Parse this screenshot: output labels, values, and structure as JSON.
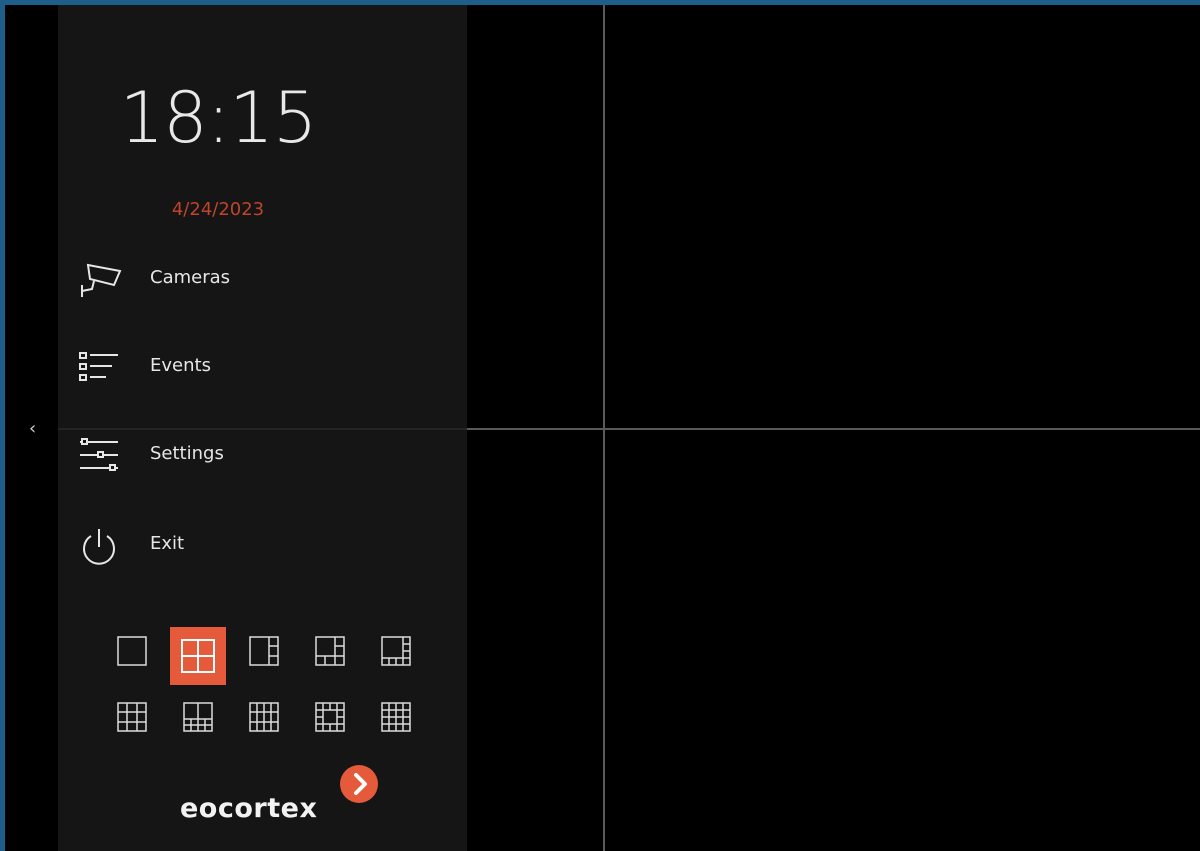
{
  "clock": {
    "time": "18:15",
    "date": "4/24/2023"
  },
  "menu": [
    {
      "label": "Cameras",
      "icon": "camera-icon"
    },
    {
      "label": "Events",
      "icon": "events-list-icon"
    },
    {
      "label": "Settings",
      "icon": "settings-sliders-icon"
    },
    {
      "label": "Exit",
      "icon": "power-icon"
    }
  ],
  "layouts": {
    "selected_index": 1,
    "items": [
      "1x1",
      "2x2",
      "1+3",
      "1+5",
      "1+7",
      "3x3",
      "2+8",
      "4x3",
      "1+12",
      "4x4"
    ]
  },
  "logo": {
    "text": "eocortex"
  },
  "colors": {
    "accent": "#e55a3a",
    "date": "#c0432c",
    "sidebar_bg": "#151515",
    "view_bg": "#000000",
    "frame_border": "#1d5f8a"
  },
  "collapse_icon": "chevron-left-icon"
}
